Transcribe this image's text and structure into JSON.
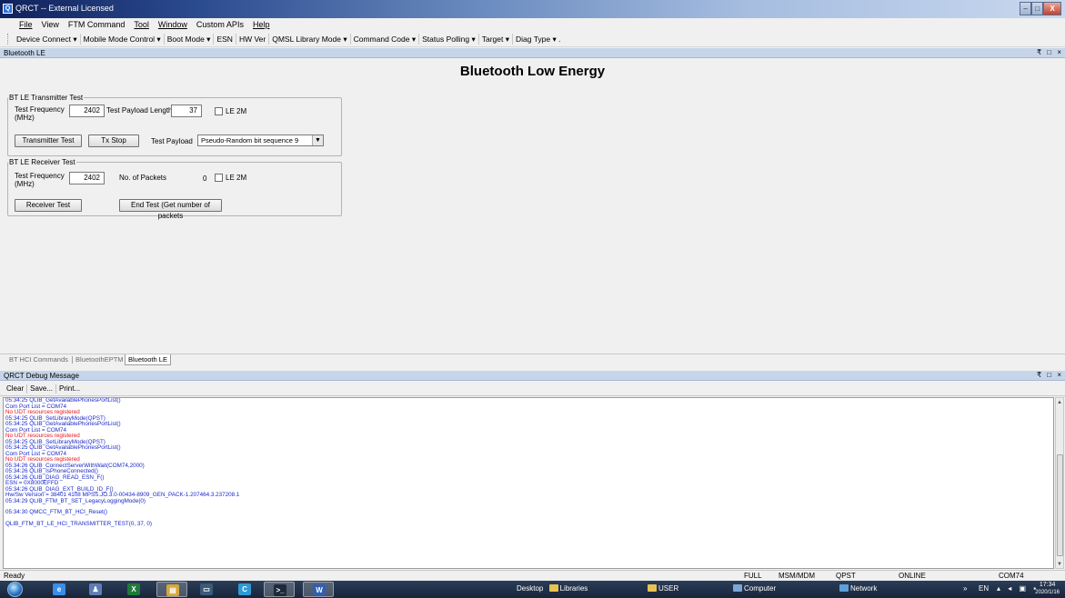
{
  "window": {
    "title": "QRCT -- External Licensed"
  },
  "menu": [
    {
      "label": "File",
      "u": true
    },
    {
      "label": "View",
      "u": false
    },
    {
      "label": "FTM Command",
      "u": false
    },
    {
      "label": "Tool",
      "u": true
    },
    {
      "label": "Window",
      "u": true
    },
    {
      "label": "Custom APIs",
      "u": false
    },
    {
      "label": "Help",
      "u": true
    }
  ],
  "toolbar": [
    "Device Connect ▾",
    "Mobile Mode Control ▾",
    "Boot Mode ▾",
    "ESN",
    "HW Ver",
    "QMSL Library Mode ▾",
    "Command Code ▾",
    "Status Polling ▾",
    "Target ▾",
    "Diag Type ▾ ."
  ],
  "ble_panel": {
    "header": "Bluetooth LE",
    "header_btns": "₹ □ ×",
    "title": "Bluetooth Low Energy",
    "tx": {
      "legend": "BT LE Transmitter Test",
      "freq_label": "Test Frequency (MHz)",
      "freq_value": "2402",
      "payload_len_label": "Test Payload Length",
      "payload_len_value": "37",
      "le2m_label": "LE 2M",
      "tx_test_btn": "Transmitter Test",
      "tx_stop_btn": "Tx Stop",
      "payload_label": "Test Payload",
      "payload_value": "Pseudo-Random bit sequence 9"
    },
    "rx": {
      "legend": "BT LE Receiver Test",
      "freq_label": "Test Frequency (MHz)",
      "freq_value": "2402",
      "packets_label": "No. of Packets",
      "packets_value": "0",
      "le2m_label": "LE 2M",
      "rx_test_btn": "Receiver Test",
      "end_test_btn": "End Test (Get number of packets"
    }
  },
  "doc_tabs": [
    "BT HCI Commands",
    "BluetoothEPTM",
    "Bluetooth LE"
  ],
  "debug_panel": {
    "header": "QRCT Debug Message",
    "header_btns": "₹ □ ×",
    "buttons": [
      "Clear",
      "Save...",
      "Print..."
    ],
    "lines": [
      {
        "t": "05:34:25  QLIB_GetAvailablePhonesPortList()",
        "c": "blue"
      },
      {
        "t": "Com Port List = COM74",
        "c": "blue"
      },
      {
        "t": "No UDT resources registered",
        "c": "red"
      },
      {
        "t": "05:34:25  QLIB_SetLibraryMode(QPST)",
        "c": "blue"
      },
      {
        "t": "05:34:25  QLIB_GetAvailablePhonesPortList()",
        "c": "blue"
      },
      {
        "t": "Com Port List = COM74",
        "c": "blue"
      },
      {
        "t": "No UDT resources registered",
        "c": "red"
      },
      {
        "t": "05:34:25  QLIB_SetLibraryMode(QPST)",
        "c": "blue"
      },
      {
        "t": "05:34:25  QLIB_GetAvailablePhonesPortList()",
        "c": "blue"
      },
      {
        "t": "Com Port List = COM74",
        "c": "blue"
      },
      {
        "t": "No UDT resources registered",
        "c": "red"
      },
      {
        "t": "05:34:26  QLIB_ConnectServerWithWait(COM74,2000)",
        "c": "blue"
      },
      {
        "t": "05:34:26  QLIB_IsPhoneConnected()",
        "c": "blue"
      },
      {
        "t": "05:34:26  QLIB_DIAG_READ_ESN_F()",
        "c": "blue"
      },
      {
        "t": "ESN = 0X8000EFFD",
        "c": "blue"
      },
      {
        "t": "05:34:26  QLIB_DIAG_EXT_BUILD_ID_F()",
        "c": "blue"
      },
      {
        "t": "Hw/Sw Version = 38401  4108  MPSS.JO.3.0-00434-8909_GEN_PACK-1.207464.3.237208.1",
        "c": "blue"
      },
      {
        "t": "05:34:29  QLIB_FTM_BT_SET_LegacyLoggingMode(0)",
        "c": "blue"
      },
      {
        "t": "",
        "c": "gap"
      },
      {
        "t": "05:34:30  QMCC_FTM_BT_HCI_Reset()",
        "c": "blue"
      },
      {
        "t": "",
        "c": "gap"
      },
      {
        "t": "QLIB_FTM_BT_LE_HCI_TRANSMITTER_TEST(0, 37, 0)",
        "c": "blue"
      }
    ]
  },
  "status": {
    "left": "Ready",
    "full": "FULL",
    "msm": "MSM/MDM",
    "qpst": "QPST",
    "online": "ONLINE",
    "port": "COM74"
  },
  "taskbar": {
    "apps": [
      {
        "name": "ie-icon",
        "label": "e",
        "color": "#3a8ee8",
        "active": false
      },
      {
        "name": "people-icon",
        "label": "♟",
        "color": "#5f7db5",
        "active": false
      },
      {
        "name": "excel-icon",
        "label": "X",
        "color": "#1f7a3a",
        "active": false
      },
      {
        "name": "explorer-icon",
        "label": "▤",
        "color": "#d6a73a",
        "active": true
      },
      {
        "name": "monitor-icon",
        "label": "▭",
        "color": "#3c5a7a",
        "active": false
      },
      {
        "name": "app-icon",
        "label": "C",
        "color": "#2d9ad6",
        "active": false
      },
      {
        "name": "terminal-icon",
        "label": ">_",
        "color": "#1e2a3a",
        "active": true
      },
      {
        "name": "word-icon",
        "label": "W",
        "color": "#2f5fb3",
        "active": true
      }
    ],
    "desktop": "Desktop",
    "libraries": "Libraries",
    "user": "USER",
    "computer": "Computer",
    "network": "Network",
    "lang": "EN",
    "time": "17:34",
    "date": "2020/1/16"
  }
}
